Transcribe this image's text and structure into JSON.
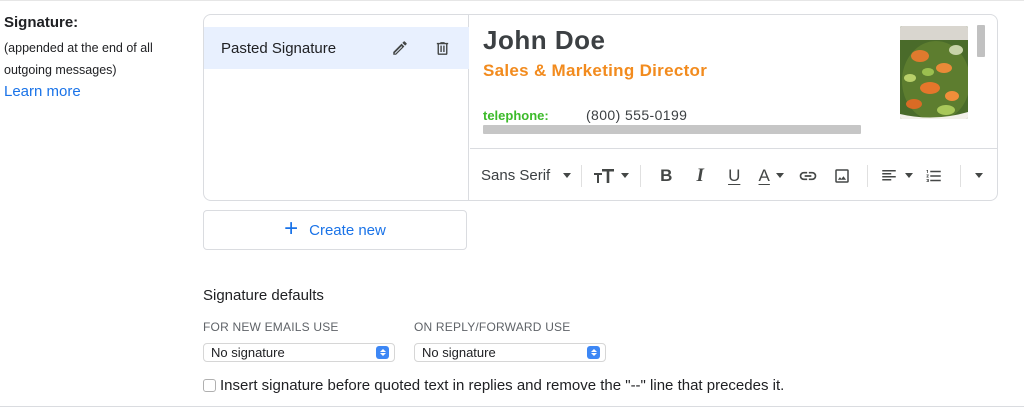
{
  "signature_section": {
    "title": "Signature:",
    "description_line1": "(appended at the end of all",
    "description_line2": "outgoing messages)",
    "learn_more": "Learn more"
  },
  "signatures_list": [
    {
      "name": "Pasted Signature",
      "selected": true
    }
  ],
  "preview": {
    "name": "John Doe",
    "role": "Sales & Marketing Director",
    "phone_label": "telephone:",
    "phone_value": "(800) 555-0199",
    "colors": {
      "name": "#3c4043",
      "role": "#f28b1e",
      "phone_label": "#3cba2a"
    }
  },
  "toolbar": {
    "font": "Sans Serif",
    "items": [
      "font-size-icon",
      "bold-icon",
      "italic-icon",
      "underline-icon",
      "text-color-icon",
      "link-icon",
      "image-icon",
      "align-icon",
      "numbered-list-icon",
      "more-icon"
    ],
    "bold": "B",
    "italic": "I",
    "underline": "U",
    "text_color": "A"
  },
  "create_new": {
    "label": "Create new"
  },
  "defaults": {
    "title": "Signature defaults",
    "new_emails_label": "FOR NEW EMAILS USE",
    "new_emails_value": "No signature",
    "reply_label": "ON REPLY/FORWARD USE",
    "reply_value": "No signature"
  },
  "insert_before_quoted": {
    "checked": false,
    "label": "Insert signature before quoted text in replies and remove the \"--\" line that precedes it."
  },
  "accent_color": "#1a73e8",
  "selected_row_color": "#e8f0fe"
}
